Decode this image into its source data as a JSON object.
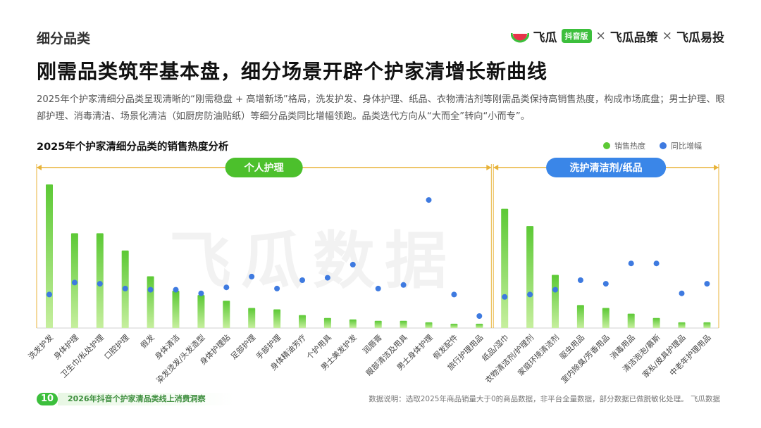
{
  "header": {
    "section_tag": "细分品类",
    "brand": {
      "part1": "飞瓜",
      "badge": "抖音版",
      "sep1": "×",
      "part2": "飞瓜品策",
      "sep2": "×",
      "part3": "飞瓜易投"
    },
    "title": "刚需品类筑牢基本盘，细分场景开辟个护家清增长新曲线",
    "description": "2025年个护家清细分品类呈现清晰的“刚需稳盘 + 高增新场”格局，洗发护发、身体护理、纸品、衣物清洁剂等刚需品类保持高销售热度，构成市场底盘；男士护理、眼部护理、消毒清洁、场景化清洁（如厨房防油贴纸）等细分品类同比增幅领跑。品类迭代方向从“大而全”转向“小而专”。"
  },
  "watermark": "飞瓜数据",
  "footer": {
    "page_number": "10",
    "report_name": "2026年抖音个护家清品类线上消费洞察",
    "note": "数据说明：选取2025年商品销量大于0的商品数据，非平台全量数据，部分数据已做脱敏化处理。 飞瓜数据"
  },
  "colors": {
    "bar": "#5cc935",
    "bar_light": "#c6ef9e",
    "dot": "#3e7ae0",
    "bracket": "#e8b339",
    "group_badge_1": "#4cc02c",
    "group_badge_2": "#3a86e8"
  },
  "chart_data": {
    "type": "bar",
    "title": "2025年个护家清细分品类的销售热度分析",
    "legend": {
      "position": "top-right",
      "items": [
        "销售热度",
        "同比增幅"
      ]
    },
    "groups": [
      {
        "label": "个人护理",
        "start": 0,
        "end": 17
      },
      {
        "label": "洗护清洁剂/纸品",
        "start": 18,
        "end": 26
      }
    ],
    "categories": [
      "洗发护发",
      "身体护理",
      "卫生巾/私处护理",
      "口腔护理",
      "假发",
      "身体清洁",
      "染发烫发/头发造型",
      "身体护理贴",
      "足部护理",
      "手部护理",
      "身体精油芳疗",
      "个护用具",
      "男士美发护发",
      "润唇膏",
      "眼部清洁及用具",
      "男士身体护理",
      "假发配件",
      "旅行护理用品",
      "纸品/湿巾",
      "衣物清洁剂/护理剂",
      "家庭环境清洁剂",
      "驱虫用品",
      "室内除臭/芳香用品",
      "消毒用品",
      "清洁泡泡/慕斯",
      "家私/皮具护理品",
      "中老年护理用品"
    ],
    "series": [
      {
        "name": "销售热度",
        "kind": "bar",
        "values": [
          100,
          66,
          66,
          54,
          36,
          26,
          23,
          19,
          14,
          13,
          9,
          7,
          6,
          5,
          5,
          4,
          3,
          3,
          83,
          71,
          37,
          16,
          14,
          10,
          7,
          4,
          4
        ]
      },
      {
        "name": "同比增幅",
        "kind": "dot",
        "values": [
          28,
          38,
          37,
          33,
          32,
          32,
          29,
          34,
          43,
          33,
          40,
          42,
          53,
          33,
          36,
          107,
          28,
          10,
          26,
          28,
          32,
          40,
          37,
          54,
          54,
          29,
          37
        ]
      }
    ],
    "ylim_bar": [
      0,
      100
    ],
    "ylim_dot": [
      0,
      120
    ],
    "grid": false
  }
}
